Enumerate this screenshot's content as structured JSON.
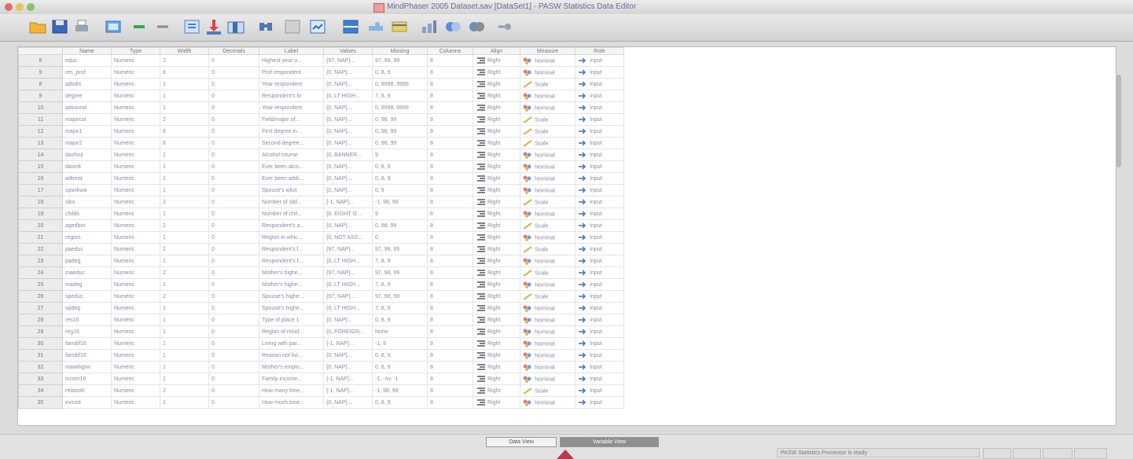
{
  "window": {
    "title": "MindPhaser 2005 Dataset.sav [DataSet1] - PASW Statistics Data Editor",
    "accent": "#5a5a9a"
  },
  "toolbar": {
    "buttons": [
      {
        "name": "open-folder-icon"
      },
      {
        "name": "save-icon"
      },
      {
        "name": "print-icon"
      },
      {
        "name": "dialog-recall-icon"
      },
      {
        "name": "undo-icon"
      },
      {
        "name": "redo-icon"
      },
      {
        "name": "goto-case-icon"
      },
      {
        "name": "goto-variable-icon"
      },
      {
        "name": "variables-icon"
      },
      {
        "name": "find-icon"
      },
      {
        "name": "insert-cases-icon"
      },
      {
        "name": "insert-variable-icon"
      },
      {
        "name": "split-file-icon"
      },
      {
        "name": "weight-cases-icon"
      },
      {
        "name": "select-cases-icon"
      },
      {
        "name": "value-labels-icon"
      },
      {
        "name": "use-sets-icon"
      },
      {
        "name": "show-all-variables-icon"
      },
      {
        "name": "spelling-icon"
      }
    ]
  },
  "columns": [
    "Name",
    "Type",
    "Width",
    "Decimals",
    "Label",
    "Values",
    "Missing",
    "Columns",
    "Align",
    "Measure",
    "Role"
  ],
  "rows": [
    {
      "num": "8",
      "name": "educ",
      "type": "Numeric",
      "width": "2",
      "decimals": "0",
      "label": "Highest year o...",
      "values": "{97, NAP}...",
      "missing": "97, 98, 99",
      "columns": "8",
      "align": "Right",
      "measure": "Nominal",
      "role": "Input"
    },
    {
      "num": "9",
      "name": "res_prof",
      "type": "Numeric",
      "width": "8",
      "decimals": "0",
      "label": "Prof respondent",
      "values": "{0, NAP}...",
      "missing": "0, 8, 9",
      "columns": "8",
      "align": "Right",
      "measure": "Nominal",
      "role": "Input"
    },
    {
      "num": "8",
      "name": "adsdis",
      "type": "Numeric",
      "width": "1",
      "decimals": "0",
      "label": "Year respondent",
      "values": "{0, NAP}...",
      "missing": "0, 9998, 9999",
      "columns": "8",
      "align": "Right",
      "measure": "Scale",
      "role": "Input"
    },
    {
      "num": "9",
      "name": "degree",
      "type": "Numeric",
      "width": "1",
      "decimals": "0",
      "label": "Respondent's hi",
      "values": "{0, LT HIGH...",
      "missing": "7, 8, 9",
      "columns": "8",
      "align": "Right",
      "measure": "Nominal",
      "role": "Input"
    },
    {
      "num": "10",
      "name": "adsound",
      "type": "Numeric",
      "width": "1",
      "decimals": "0",
      "label": "Year respondent",
      "values": "{0, NAP}...",
      "missing": "0, 9998, 9999",
      "columns": "8",
      "align": "Right",
      "measure": "Nominal",
      "role": "Input"
    },
    {
      "num": "11",
      "name": "majorcol",
      "type": "Numeric",
      "width": "2",
      "decimals": "0",
      "label": "Field/major of...",
      "values": "{0, NAP}...",
      "missing": "0, 98, 99",
      "columns": "8",
      "align": "Right",
      "measure": "Scale",
      "role": "Input"
    },
    {
      "num": "12",
      "name": "major1",
      "type": "Numeric",
      "width": "8",
      "decimals": "0",
      "label": "First degree in...",
      "values": "{0, NAP}...",
      "missing": "0, 98, 99",
      "columns": "8",
      "align": "Right",
      "measure": "Scale",
      "role": "Input"
    },
    {
      "num": "13",
      "name": "major2",
      "type": "Numeric",
      "width": "8",
      "decimals": "0",
      "label": "Second degree...",
      "values": "{0, NAP}...",
      "missing": "0, 98, 99",
      "columns": "8",
      "align": "Right",
      "measure": "Scale",
      "role": "Input"
    },
    {
      "num": "14",
      "name": "dasfoul",
      "type": "Numeric",
      "width": "1",
      "decimals": "0",
      "label": "Alcohol course",
      "values": "{0, BANNER...",
      "missing": "9",
      "columns": "8",
      "align": "Right",
      "measure": "Nominal",
      "role": "Input"
    },
    {
      "num": "15",
      "name": "dasink",
      "type": "Numeric",
      "width": "1",
      "decimals": "0",
      "label": "Ever been alco...",
      "values": "{0, NAP}...",
      "missing": "0, 8, 9",
      "columns": "8",
      "align": "Right",
      "measure": "Nominal",
      "role": "Input"
    },
    {
      "num": "16",
      "name": "adtreat",
      "type": "Numeric",
      "width": "1",
      "decimals": "0",
      "label": "Ever been addi...",
      "values": "{0, NAP}...",
      "missing": "0, 8, 9",
      "columns": "8",
      "align": "Right",
      "measure": "Nominal",
      "role": "Input"
    },
    {
      "num": "17",
      "name": "spwrkwa",
      "type": "Numeric",
      "width": "1",
      "decimals": "0",
      "label": "Spouse's wkst",
      "values": "{0, NAP}...",
      "missing": "0, 9",
      "columns": "8",
      "align": "Right",
      "measure": "Nominal",
      "role": "Input"
    },
    {
      "num": "18",
      "name": "sibs",
      "type": "Numeric",
      "width": "2",
      "decimals": "0",
      "label": "Number of sibl...",
      "values": "{-1, NAP}...",
      "missing": "-1, 98, 99",
      "columns": "8",
      "align": "Right",
      "measure": "Scale",
      "role": "Input"
    },
    {
      "num": "19",
      "name": "childs",
      "type": "Numeric",
      "width": "1",
      "decimals": "0",
      "label": "Number of chil...",
      "values": "{8, EIGHT O...",
      "missing": "9",
      "columns": "8",
      "align": "Right",
      "measure": "Nominal",
      "role": "Input"
    },
    {
      "num": "20",
      "name": "agedbot",
      "type": "Numeric",
      "width": "2",
      "decimals": "0",
      "label": "Respondent's a...",
      "values": "{0, NAP}...",
      "missing": "0, 98, 99",
      "columns": "8",
      "align": "Right",
      "measure": "Scale",
      "role": "Input"
    },
    {
      "num": "21",
      "name": "region",
      "type": "Numeric",
      "width": "1",
      "decimals": "0",
      "label": "Region in whic...",
      "values": "{0, NOT ASS...",
      "missing": "0",
      "columns": "8",
      "align": "Right",
      "measure": "Nominal",
      "role": "Input"
    },
    {
      "num": "22",
      "name": "paeduc",
      "type": "Numeric",
      "width": "2",
      "decimals": "0",
      "label": "Respondent's f...",
      "values": "{97, NAP}...",
      "missing": "97, 98, 99",
      "columns": "8",
      "align": "Right",
      "measure": "Scale",
      "role": "Input"
    },
    {
      "num": "23",
      "name": "padeg",
      "type": "Numeric",
      "width": "1",
      "decimals": "0",
      "label": "Respondent's f...",
      "values": "{0, LT HIGH...",
      "missing": "7, 8, 9",
      "columns": "8",
      "align": "Right",
      "measure": "Nominal",
      "role": "Input"
    },
    {
      "num": "24",
      "name": "maeduc",
      "type": "Numeric",
      "width": "2",
      "decimals": "0",
      "label": "Mother's highe...",
      "values": "{97, NAP}...",
      "missing": "97, 98, 99",
      "columns": "8",
      "align": "Right",
      "measure": "Scale",
      "role": "Input"
    },
    {
      "num": "25",
      "name": "madeg",
      "type": "Numeric",
      "width": "1",
      "decimals": "0",
      "label": "Mother's highe...",
      "values": "{0, LT HIGH...",
      "missing": "7, 8, 9",
      "columns": "8",
      "align": "Right",
      "measure": "Nominal",
      "role": "Input"
    },
    {
      "num": "26",
      "name": "speduc",
      "type": "Numeric",
      "width": "2",
      "decimals": "0",
      "label": "Spouse's highe...",
      "values": "{97, NAP}...",
      "missing": "97, 98, 99",
      "columns": "8",
      "align": "Right",
      "measure": "Scale",
      "role": "Input"
    },
    {
      "num": "27",
      "name": "spdeg",
      "type": "Numeric",
      "width": "1",
      "decimals": "0",
      "label": "Spouse's highe...",
      "values": "{0, LT HIGH...",
      "missing": "7, 8, 9",
      "columns": "8",
      "align": "Right",
      "measure": "Nominal",
      "role": "Input"
    },
    {
      "num": "28",
      "name": "res16",
      "type": "Numeric",
      "width": "1",
      "decimals": "0",
      "label": "Type of place 1",
      "values": "{0, NAP}...",
      "missing": "0, 8, 9",
      "columns": "8",
      "align": "Right",
      "measure": "Nominal",
      "role": "Input"
    },
    {
      "num": "29",
      "name": "reg16",
      "type": "Numeric",
      "width": "1",
      "decimals": "0",
      "label": "Region of resid...",
      "values": "{0, FOREIGN...",
      "missing": "None",
      "columns": "8",
      "align": "Right",
      "measure": "Nominal",
      "role": "Input"
    },
    {
      "num": "30",
      "name": "famdif16",
      "type": "Numeric",
      "width": "1",
      "decimals": "0",
      "label": "Living with par...",
      "values": "{-1, NAP}...",
      "missing": "-1, 9",
      "columns": "8",
      "align": "Right",
      "measure": "Nominal",
      "role": "Input"
    },
    {
      "num": "31",
      "name": "famdif16",
      "type": "Numeric",
      "width": "1",
      "decimals": "0",
      "label": "Reason not livi...",
      "values": "{0, NAP}...",
      "missing": "0, 8, 9",
      "columns": "8",
      "align": "Right",
      "measure": "Nominal",
      "role": "Input"
    },
    {
      "num": "32",
      "name": "mawrkgrw",
      "type": "Numeric",
      "width": "1",
      "decimals": "0",
      "label": "Mother's emplo...",
      "values": "{0, NAP}...",
      "missing": "0, 8, 9",
      "columns": "8",
      "align": "Right",
      "measure": "Nominal",
      "role": "Input"
    },
    {
      "num": "33",
      "name": "incom16",
      "type": "Numeric",
      "width": "1",
      "decimals": "0",
      "label": "Family income...",
      "values": "{-1, NAP}...",
      "missing": "-1, -nv, -1",
      "columns": "8",
      "align": "Right",
      "measure": "Nominal",
      "role": "Input"
    },
    {
      "num": "34",
      "name": "relasoth",
      "type": "Numeric",
      "width": "2",
      "decimals": "0",
      "label": "How many time...",
      "values": "{-1, NAP}...",
      "missing": "-1, 98, 99",
      "columns": "8",
      "align": "Right",
      "measure": "Scale",
      "role": "Input"
    },
    {
      "num": "35",
      "name": "evinsti",
      "type": "Numeric",
      "width": "1",
      "decimals": "0",
      "label": "How much time...",
      "values": "{0, NAP}...",
      "missing": "0, 8, 9",
      "columns": "8",
      "align": "Right",
      "measure": "Nominal",
      "role": "Input"
    }
  ],
  "views": {
    "data_view": "Data View",
    "variable_view": "Variable View"
  },
  "status": {
    "text": "PASW Statistics Processor is ready"
  }
}
